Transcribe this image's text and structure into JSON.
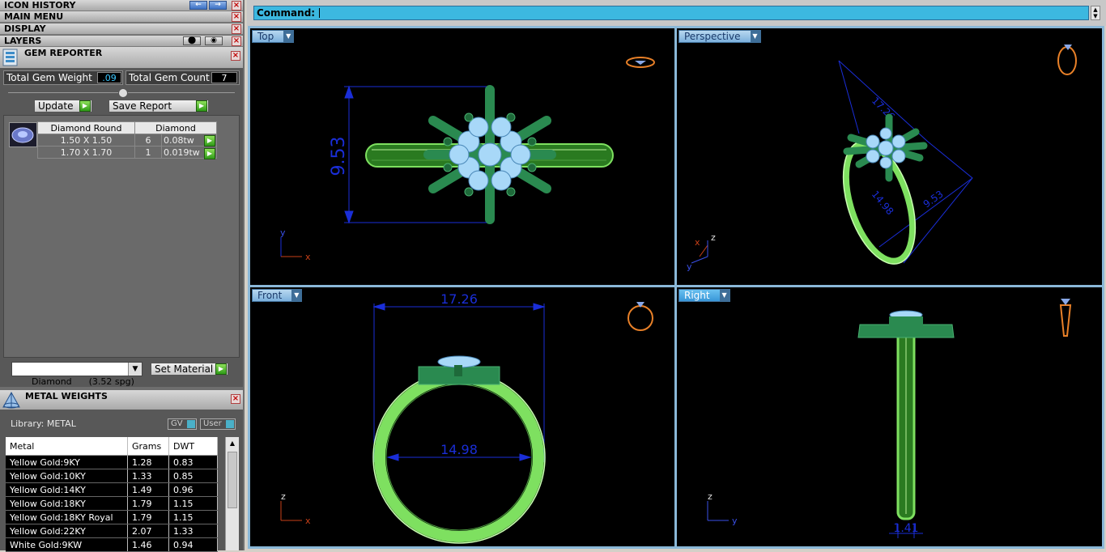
{
  "left_panel": {
    "headers": [
      "ICON HISTORY",
      "MAIN MENU",
      "DISPLAY",
      "LAYERS"
    ],
    "gem_reporter": {
      "title": "GEM REPORTER",
      "total_weight_label": "Total Gem Weight",
      "total_weight_value": ".09",
      "total_count_label": "Total Gem Count",
      "total_count_value": "7",
      "update_label": "Update",
      "save_report_label": "Save Report",
      "table_header": [
        "Diamond Round",
        "Diamond"
      ],
      "rows": [
        {
          "size": "1.50 X 1.50",
          "count": "6",
          "weight": "0.08tw"
        },
        {
          "size": "1.70 X 1.70",
          "count": "1",
          "weight": "0.019tw"
        }
      ],
      "material_select": "Diamond      (3.52 spg)",
      "set_material_label": "Set Material"
    },
    "metal_weights": {
      "title": "METAL WEIGHTS",
      "library_label": "Library: METAL",
      "gv_label": "GV",
      "user_label": "User",
      "columns": [
        "Metal",
        "Grams",
        "DWT"
      ],
      "rows": [
        {
          "metal": "Yellow Gold:9KY",
          "grams": "1.28",
          "dwt": "0.83"
        },
        {
          "metal": "Yellow Gold:10KY",
          "grams": "1.33",
          "dwt": "0.85"
        },
        {
          "metal": "Yellow Gold:14KY",
          "grams": "1.49",
          "dwt": "0.96"
        },
        {
          "metal": "Yellow Gold:18KY",
          "grams": "1.79",
          "dwt": "1.15"
        },
        {
          "metal": "Yellow Gold:18KY Royal",
          "grams": "1.79",
          "dwt": "1.15"
        },
        {
          "metal": "Yellow Gold:22KY",
          "grams": "2.07",
          "dwt": "1.33"
        },
        {
          "metal": "White Gold:9KW",
          "grams": "1.46",
          "dwt": "0.94"
        }
      ]
    }
  },
  "command": {
    "label": "Command:"
  },
  "viewports": {
    "top": {
      "label": "Top",
      "dimension": "9.53",
      "axis_x": "x",
      "axis_y": "y"
    },
    "perspective": {
      "label": "Perspective",
      "dim_a": "17.26",
      "dim_b": "14.98",
      "dim_c": "9.53",
      "axis_x": "x",
      "axis_y": "y",
      "axis_z": "z"
    },
    "front": {
      "label": "Front",
      "dim_width": "17.26",
      "dim_inner": "14.98",
      "axis_x": "x",
      "axis_z": "z"
    },
    "right": {
      "label": "Right",
      "dim_shank": "1.41",
      "axis_y": "y",
      "axis_z": "z"
    }
  },
  "colors": {
    "accent_cyan": "#3cb8e0",
    "ring_green": "#7ee060",
    "dimension_blue": "#1a2ed8",
    "gem_blue": "#a8d8f8"
  }
}
